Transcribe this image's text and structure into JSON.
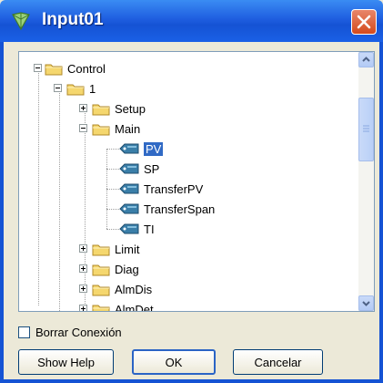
{
  "window": {
    "title": "Input01"
  },
  "tree": {
    "nodes": [
      {
        "label": "Control",
        "type": "folder",
        "expander": "minus"
      },
      {
        "label": "1",
        "type": "folder",
        "expander": "minus"
      },
      {
        "label": "Setup",
        "type": "folder",
        "expander": "plus"
      },
      {
        "label": "Main",
        "type": "folder",
        "expander": "minus"
      },
      {
        "label": "PV",
        "type": "leaf",
        "selected": true
      },
      {
        "label": "SP",
        "type": "leaf"
      },
      {
        "label": "TransferPV",
        "type": "leaf"
      },
      {
        "label": "TransferSpan",
        "type": "leaf"
      },
      {
        "label": "TI",
        "type": "leaf"
      },
      {
        "label": "Limit",
        "type": "folder",
        "expander": "plus"
      },
      {
        "label": "Diag",
        "type": "folder",
        "expander": "plus"
      },
      {
        "label": "AlmDis",
        "type": "folder",
        "expander": "plus"
      },
      {
        "label": "AlmDet",
        "type": "folder",
        "expander": "plus"
      }
    ]
  },
  "checkbox": {
    "label": "Borrar Conexión",
    "checked": false
  },
  "buttons": {
    "help": "Show Help",
    "ok": "OK",
    "cancel": "Cancelar"
  },
  "colors": {
    "titlebar": "#1f5ee0",
    "selection": "#316ac5",
    "dialog_bg": "#ece9d8",
    "folder": "#f5d76e"
  },
  "icons": {
    "title": "component-icon",
    "close": "close-icon",
    "folder": "folder-icon",
    "leaf": "tag-icon"
  }
}
